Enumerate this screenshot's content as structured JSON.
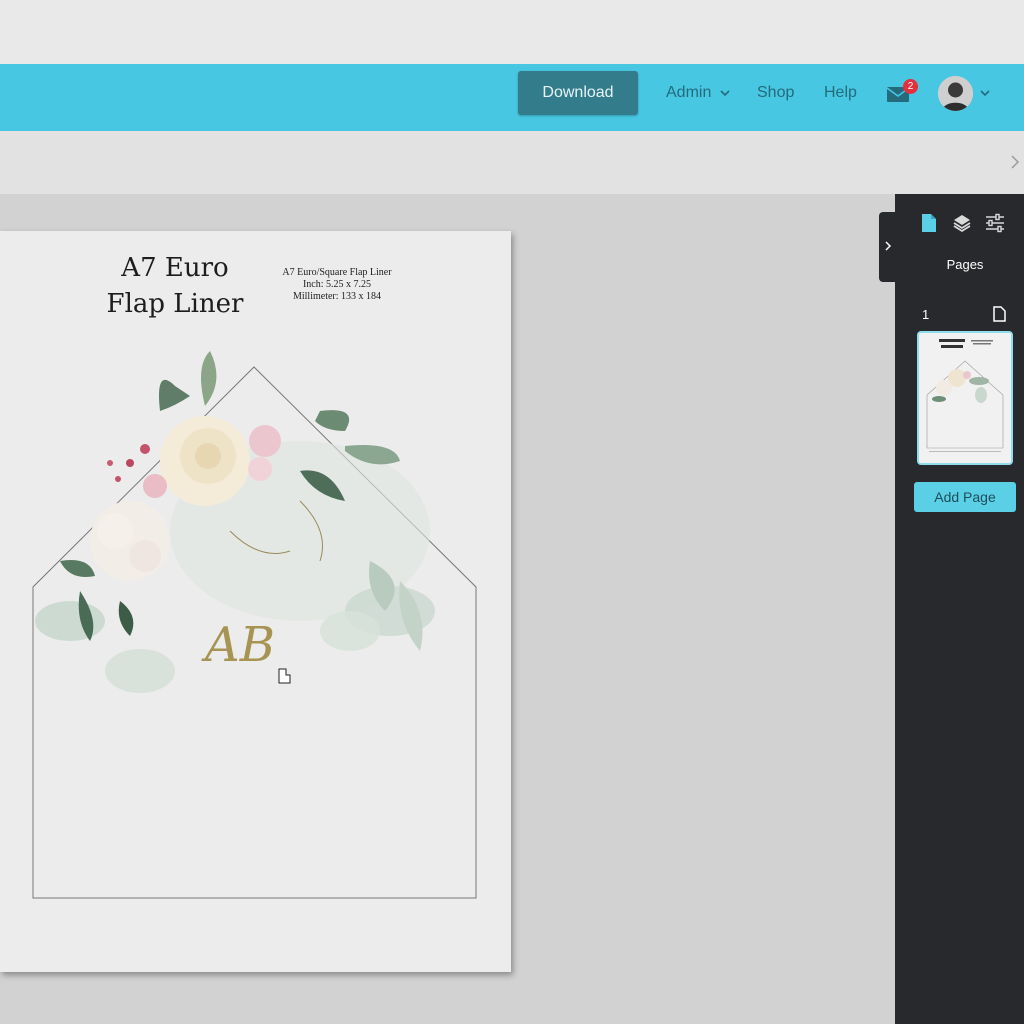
{
  "navbar": {
    "download_label": "Download",
    "admin_label": "Admin",
    "shop_label": "Shop",
    "help_label": "Help",
    "mail_badge_count": "2"
  },
  "document": {
    "title_line1": "A7 Euro",
    "title_line2": "Flap Liner",
    "info_line1": "A7 Euro/Square Flap Liner",
    "info_line2": "Inch: 5.25 x 7.25",
    "info_line3": "Millimeter: 133 x 184",
    "monogram": "AB"
  },
  "panel": {
    "section_title": "Pages",
    "page_number": "1",
    "add_page_label": "Add Page"
  },
  "colors": {
    "navbar": "#47c7e2",
    "download_button": "#337c8c",
    "panel_bg": "#27292c",
    "accent": "#5bcfe6",
    "badge": "#e3303f"
  },
  "icons": {
    "pages_tool": "document-icon",
    "layers_tool": "layers-icon",
    "settings_tool": "sliders-icon",
    "mail": "mail-icon",
    "collapse": "chevron-right-icon"
  }
}
